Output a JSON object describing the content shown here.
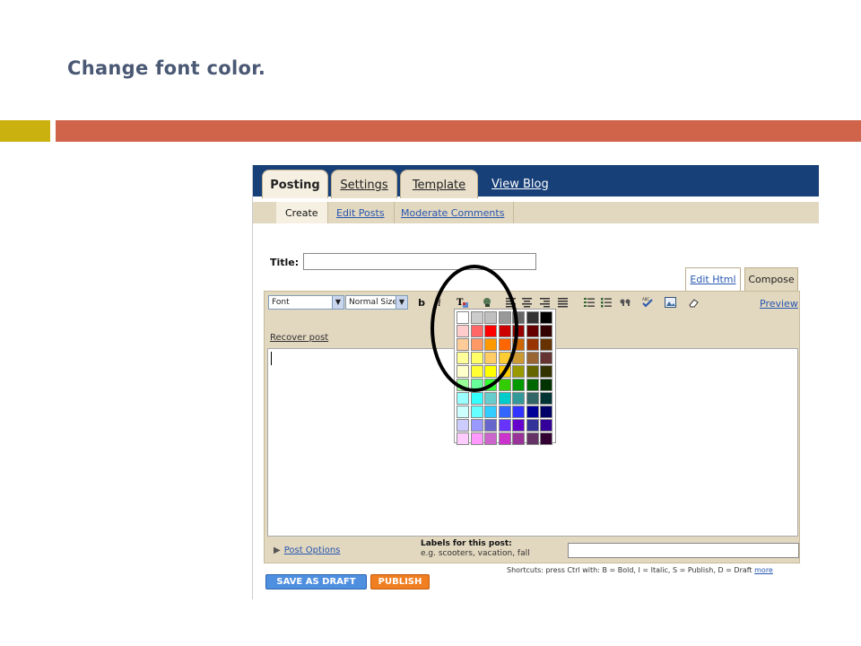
{
  "slide": {
    "title": "Change font color.",
    "bar_colors": {
      "yellow": "#cbb10f",
      "orange": "#d0644a"
    }
  },
  "blogger": {
    "nav_color": "#173f78",
    "tabs": [
      "Posting",
      "Settings",
      "Template"
    ],
    "view_blog": "View Blog",
    "subnav": [
      "Create",
      "Edit Posts",
      "Moderate Comments"
    ],
    "title_label": "Title:",
    "mode_tabs": {
      "edit_html": "Edit Html",
      "compose": "Compose"
    },
    "toolbar": {
      "font_select": "Font",
      "size_select": "Normal Size",
      "bold": "b",
      "italic": "i",
      "icons": [
        "text-color-icon",
        "link-icon",
        "align-left-icon",
        "align-center-icon",
        "align-right-icon",
        "justify-icon",
        "numbered-list-icon",
        "bulleted-list-icon",
        "blockquote-icon",
        "spellcheck-icon",
        "image-icon",
        "eraser-icon"
      ],
      "preview": "Preview"
    },
    "recover_post": "Recover post",
    "post_options": "Post Options",
    "labels_title": "Labels for this post:",
    "labels_example": "e.g. scooters, vacation, fall",
    "shortcuts": "Shortcuts: press Ctrl with: B = Bold, I = Italic, S = Publish, D = Draft",
    "shortcuts_more": "more",
    "save_draft": "SAVE AS DRAFT",
    "publish": "PUBLISH"
  },
  "color_palette": [
    [
      "#ffffff",
      "#cccccc",
      "#c0c0c0",
      "#999999",
      "#666666",
      "#333333",
      "#000000"
    ],
    [
      "#ffcccc",
      "#ff6666",
      "#ff0000",
      "#cc0000",
      "#990000",
      "#660000",
      "#330000"
    ],
    [
      "#ffcc99",
      "#ff9966",
      "#ff9900",
      "#ff6600",
      "#cc6600",
      "#993300",
      "#663300"
    ],
    [
      "#ffff99",
      "#ffff66",
      "#ffcc66",
      "#ffcc33",
      "#cc9933",
      "#996633",
      "#663333"
    ],
    [
      "#ffffcc",
      "#ffff33",
      "#ffff00",
      "#ffcc00",
      "#999900",
      "#666600",
      "#333300"
    ],
    [
      "#99ff99",
      "#66ff99",
      "#33ff33",
      "#33cc00",
      "#009900",
      "#006600",
      "#003300"
    ],
    [
      "#99ffff",
      "#33ffff",
      "#66cccc",
      "#00cccc",
      "#339999",
      "#336666",
      "#003333"
    ],
    [
      "#ccffff",
      "#66ffff",
      "#33ccff",
      "#3366ff",
      "#3333ff",
      "#000099",
      "#000066"
    ],
    [
      "#ccccff",
      "#9999ff",
      "#6666cc",
      "#6633ff",
      "#6600cc",
      "#333399",
      "#330099"
    ],
    [
      "#ffccff",
      "#ff99ff",
      "#cc66cc",
      "#cc33cc",
      "#993399",
      "#663366",
      "#330033"
    ]
  ]
}
